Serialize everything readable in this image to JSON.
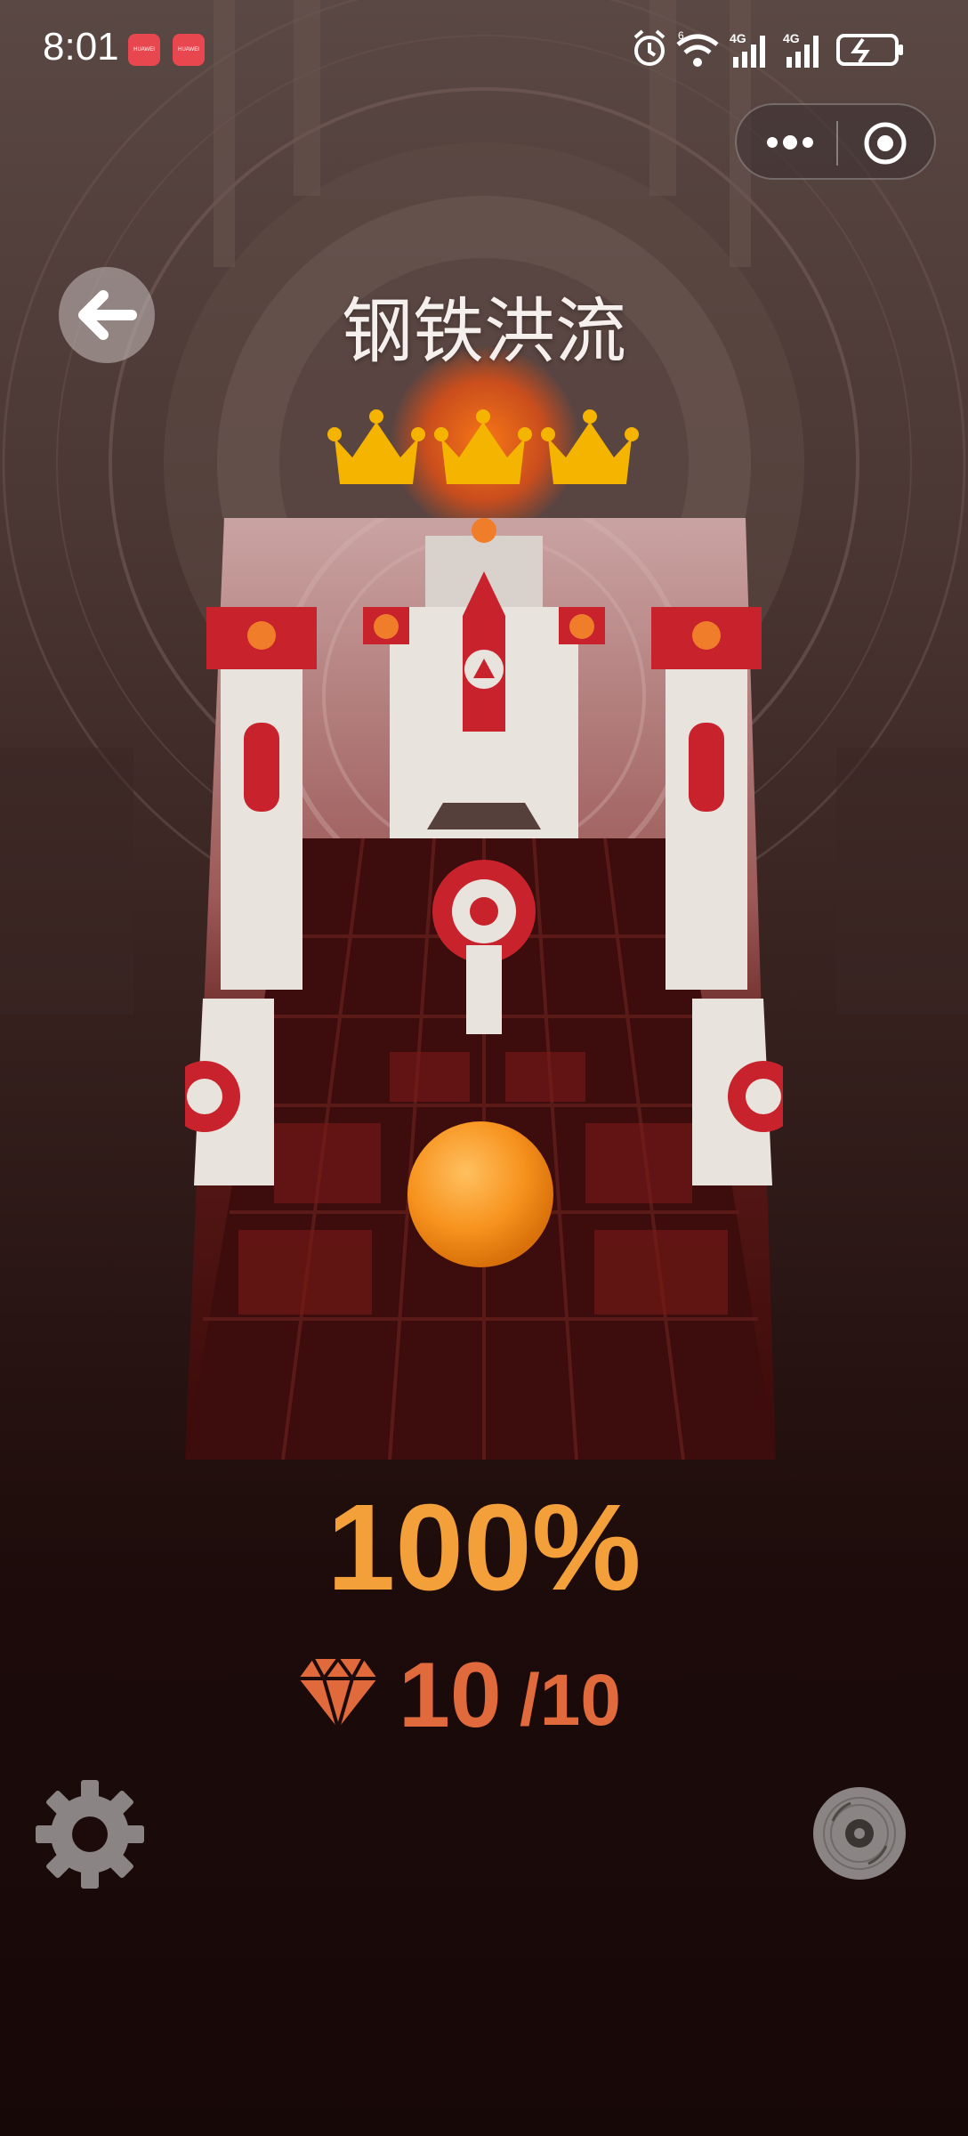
{
  "status_bar": {
    "time": "8:01",
    "badge_text": "HUAWEI",
    "icons": [
      "alarm-icon",
      "wifi-icon",
      "signal-4g-icon",
      "signal-4g-icon",
      "battery-charging-icon"
    ],
    "net_label": "4G"
  },
  "capsule": {
    "more_icon": "more-dots-icon",
    "close_icon": "target-close-icon"
  },
  "header": {
    "back_icon": "arrow-left-icon",
    "level_title": "钢铁洪流",
    "crowns_earned": 3,
    "crowns_total": 3
  },
  "results": {
    "percent_text": "100%",
    "gems_collected": "10",
    "gems_total": "/10",
    "gem_icon": "diamond-icon"
  },
  "footer": {
    "settings_icon": "gear-icon",
    "music_icon": "disc-icon"
  },
  "colors": {
    "crown": "#f5b400",
    "percent": "#f4a03a",
    "gems": "#e06a3c",
    "ball": "#f7931e",
    "accent_red": "#c8232c"
  }
}
